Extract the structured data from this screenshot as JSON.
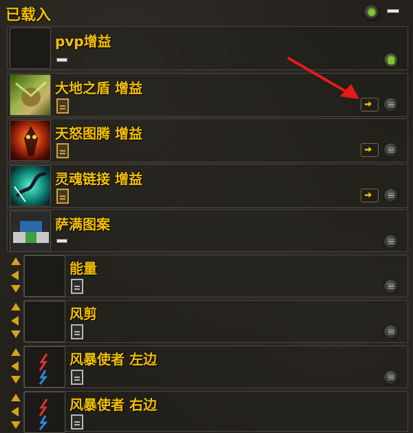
{
  "header": {
    "title": "已载入"
  },
  "groups": [
    {
      "name": "pvp增益"
    }
  ],
  "auras": [
    {
      "name": "大地之盾 增益"
    },
    {
      "name": "天怒图腾 增益"
    },
    {
      "name": "灵魂链接 增益"
    },
    {
      "name": "萨满图案"
    },
    {
      "name": "能量"
    },
    {
      "name": "风剪"
    },
    {
      "name": "风暴使者 左边"
    },
    {
      "name": "风暴使者 右边"
    }
  ],
  "colors": {
    "accent": "#f3c000",
    "active_green": "#7fc92a",
    "annotation_red": "#e31b1b"
  },
  "icons": {
    "earth_shield": "earth-shield-icon",
    "skyfury_totem": "skyfury-totem-icon",
    "spirit_link": "spirit-link-icon",
    "shaman_pattern": "shaman-pattern-icon",
    "stormbringer": "stormbringer-icon"
  }
}
